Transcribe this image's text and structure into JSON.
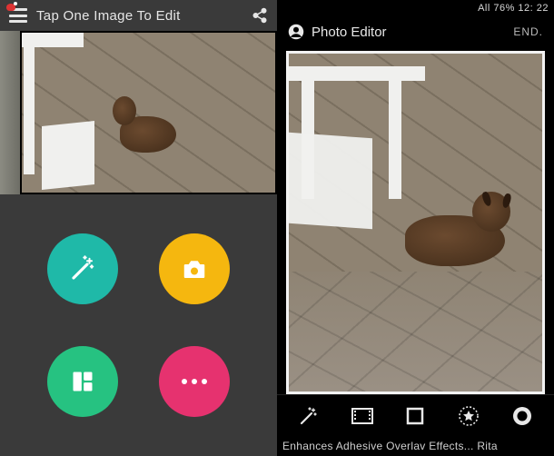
{
  "left": {
    "title": "Tap One Image To Edit",
    "menu_icon": "hamburger-menu-icon",
    "share_icon": "share-icon",
    "buttons": {
      "magic": {
        "icon": "magic-wand-icon",
        "color": "#1fb9a8"
      },
      "camera": {
        "icon": "camera-icon",
        "color": "#f5b70f"
      },
      "collage": {
        "icon": "collage-icon",
        "color": "#26c281"
      },
      "more": {
        "icon": "more-dots-icon",
        "color": "#e6326f"
      }
    }
  },
  "right": {
    "status": "All 76% 12: 22",
    "title": "Photo Editor",
    "end_label": "END.",
    "tools": [
      {
        "name": "magic-wand-icon"
      },
      {
        "name": "filmstrip-icon"
      },
      {
        "name": "crop-square-icon"
      },
      {
        "name": "star-circle-icon"
      },
      {
        "name": "vignette-circle-icon"
      }
    ],
    "caption": "Enhances Adhesive Overlav Effects... Rita"
  }
}
